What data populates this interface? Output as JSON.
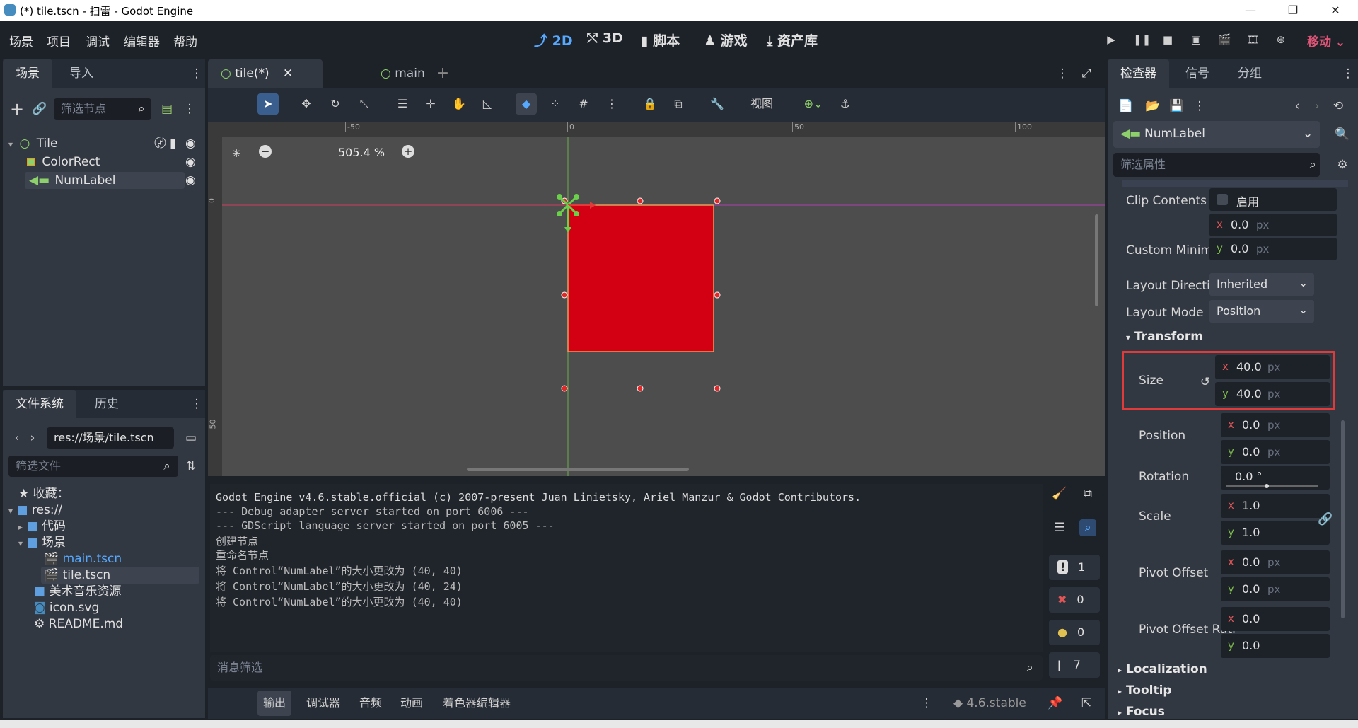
{
  "window": {
    "title": "(*) tile.tscn - 扫雷 - Godot Engine",
    "minimize": "—",
    "restore": "❐",
    "close": "✕"
  },
  "menu": {
    "items": [
      "场景",
      "项目",
      "调试",
      "编辑器",
      "帮助"
    ],
    "workspaces": [
      "2D",
      "3D",
      "脚本",
      "游戏",
      "资产库"
    ],
    "active_workspace": "2D",
    "renderer": "移动"
  },
  "scene_dock": {
    "tabs": [
      "场景",
      "导入"
    ],
    "filter_placeholder": "筛选节点",
    "nodes": [
      "Tile",
      "ColorRect",
      "NumLabel"
    ]
  },
  "filesystem_dock": {
    "tabs": [
      "文件系统",
      "历史"
    ],
    "path": "res://场景/tile.tscn",
    "filter_placeholder": "筛选文件",
    "items": [
      "收藏：",
      "res://",
      "代码",
      "场景",
      "main.tscn",
      "tile.tscn",
      "美术音乐资源",
      "icon.svg",
      "README.md"
    ]
  },
  "editor": {
    "tabs": [
      "tile(*)",
      "main"
    ],
    "view_label": "视图",
    "zoom": "505.4 %",
    "ruler_h": [
      "-50",
      "0",
      "50",
      "100"
    ],
    "ruler_v": [
      "0",
      "50"
    ]
  },
  "output": {
    "lines": [
      "Godot Engine v4.6.stable.official (c) 2007-present Juan Linietsky, Ariel Manzur & Godot Contributors.",
      "--- Debug adapter server started on port 6006 ---",
      "--- GDScript language server started on port 6005 ---",
      "创建节点",
      "重命名节点",
      "将 Control“NumLabel”的大小更改为 (40, 40)",
      "将 Control“NumLabel”的大小更改为 (40, 24)",
      "将 Control“NumLabel”的大小更改为 (40, 40)"
    ],
    "filter_placeholder": "消息筛选",
    "counts": {
      "messages": "1",
      "errors": "0",
      "warnings": "0",
      "editor": "7"
    }
  },
  "bottom_panel": {
    "tabs": [
      "输出",
      "调试器",
      "音频",
      "动画",
      "着色器编辑器"
    ],
    "version": "4.6.stable"
  },
  "inspector": {
    "tabs": [
      "检查器",
      "信号",
      "分组"
    ],
    "node": "NumLabel",
    "filter_placeholder": "筛选属性",
    "clip_contents": {
      "label": "Clip Contents",
      "value": "启用"
    },
    "custom_minimum": {
      "label": "Custom Minimu",
      "x": "0.0",
      "y": "0.0",
      "unit": "px"
    },
    "layout_direction": {
      "label": "Layout Direction",
      "value": "Inherited"
    },
    "layout_mode": {
      "label": "Layout Mode",
      "value": "Position"
    },
    "transform_section": "Transform",
    "size": {
      "label": "Size",
      "x": "40.0",
      "y": "40.0",
      "unit": "px"
    },
    "position": {
      "label": "Position",
      "x": "0.0",
      "y": "0.0",
      "unit": "px"
    },
    "rotation": {
      "label": "Rotation",
      "value": "0.0 °"
    },
    "scale": {
      "label": "Scale",
      "x": "1.0",
      "y": "1.0"
    },
    "pivot_offset": {
      "label": "Pivot Offset",
      "x": "0.0",
      "y": "0.0",
      "unit": "px"
    },
    "pivot_offset_ratio": {
      "label": "Pivot Offset Rati",
      "x": "0.0",
      "y": "0.0"
    },
    "sections": [
      "Localization",
      "Tooltip",
      "Focus"
    ]
  },
  "colors": {
    "accent": "#57a9ff",
    "rect": "#d20012",
    "highlight": "#e03a3a"
  }
}
